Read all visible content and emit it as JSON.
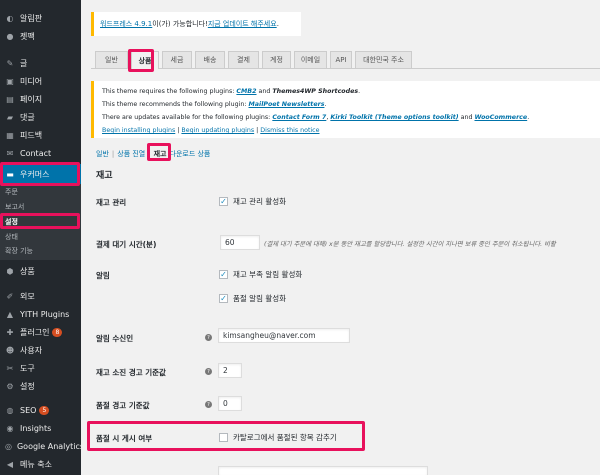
{
  "sidebar": {
    "items": [
      {
        "icon": "dashboard-icon",
        "label": "알림판"
      },
      {
        "icon": "jetpack-icon",
        "label": "젯팩"
      },
      {
        "icon": "pin-icon",
        "label": "글"
      },
      {
        "icon": "media-icon",
        "label": "미디어"
      },
      {
        "icon": "page-icon",
        "label": "페이지"
      },
      {
        "icon": "comment-icon",
        "label": "댓글"
      },
      {
        "icon": "feedback-icon",
        "label": "피드백"
      },
      {
        "icon": "contact-icon",
        "label": "Contact"
      },
      {
        "icon": "woocommerce-icon",
        "label": "우커머스"
      },
      {
        "icon": "products-icon",
        "label": "상품"
      },
      {
        "icon": "appearance-icon",
        "label": "외모"
      },
      {
        "icon": "yith-icon",
        "label": "YITH Plugins"
      },
      {
        "icon": "plugin-icon",
        "label": "플러그인",
        "badge": "8"
      },
      {
        "icon": "users-icon",
        "label": "사용자"
      },
      {
        "icon": "tools-icon",
        "label": "도구"
      },
      {
        "icon": "settings-icon",
        "label": "설정"
      },
      {
        "icon": "seo-icon",
        "label": "SEO",
        "badge": "5"
      },
      {
        "icon": "insights-icon",
        "label": "Insights"
      },
      {
        "icon": "analytics-icon",
        "label": "Google Analytics"
      },
      {
        "icon": "collapse-icon",
        "label": "메뉴 축소"
      }
    ],
    "woo_submenu": [
      "주문",
      "보고서",
      "설정",
      "상태",
      "확장 기능"
    ]
  },
  "update_notice": {
    "link": "워드프레스 4.9.1",
    "middle": "이(가) 가능합니다! ",
    "action": "지금 업데이트 해주세요",
    "end": "."
  },
  "tabs": [
    "일반",
    "상품",
    "세금",
    "배송",
    "결제",
    "계정",
    "이메일",
    "API",
    "대한민국 주소"
  ],
  "plugin_notice": {
    "line1_pre": "This theme requires the following plugins: ",
    "line1_a": "CMB2",
    "line1_and": " and ",
    "line1_b": "Themes4WP Shortcodes",
    "line1_end": ".",
    "line2_pre": "This theme recommends the following plugin: ",
    "line2_a": "MailPoet Newsletters",
    "line2_end": ".",
    "line3_pre": "There are updates available for the following plugins: ",
    "line3_a": "Contact Form 7",
    "line3_sep": ", ",
    "line3_b": "Kirki Toolkit (Theme options toolkit)",
    "line3_and": " and ",
    "line3_c": "WooCommerce",
    "line3_end": ".",
    "link1": "Begin installing plugins",
    "link2": "Begin updating plugins",
    "link3": "Dismiss this notice",
    "bar": " | "
  },
  "subsub": {
    "general": "일반",
    "advanced": "상품 진열",
    "current": "재고",
    "downloads": "다운로드 상품",
    "sep": "|"
  },
  "section_title": "재고",
  "settings": {
    "manage_label": "재고 관리",
    "manage_cb": "재고 관리 활성화",
    "hold_label": "결제 대기 시간(분)",
    "hold_value": "60",
    "hold_desc": "(결제 대기 주문에 대해) x분 동안 재고를 할당합니다. 설정한 시간이 지나면 보류 중인 주문이 취소됩니다. 비활",
    "notify_label": "알림",
    "notify_low_cb": "재고 부족 알림 활성화",
    "notify_out_cb": "품절 알림 활성화",
    "recipient_label": "알림 수신인",
    "recipient_value": "kimsangheu@naver.com",
    "low_label": "재고 소진 경고 기준값",
    "low_value": "2",
    "out_label": "품절 경고 기준값",
    "out_value": "0",
    "hide_label": "품절 시 게시 여부",
    "hide_cb": "카탈로그에서 품절된 항목 감추기"
  },
  "colors": {
    "highlight": "#e8115c",
    "sidebar_bg": "#23282d",
    "link": "#0073aa",
    "warning": "#ffb900"
  }
}
